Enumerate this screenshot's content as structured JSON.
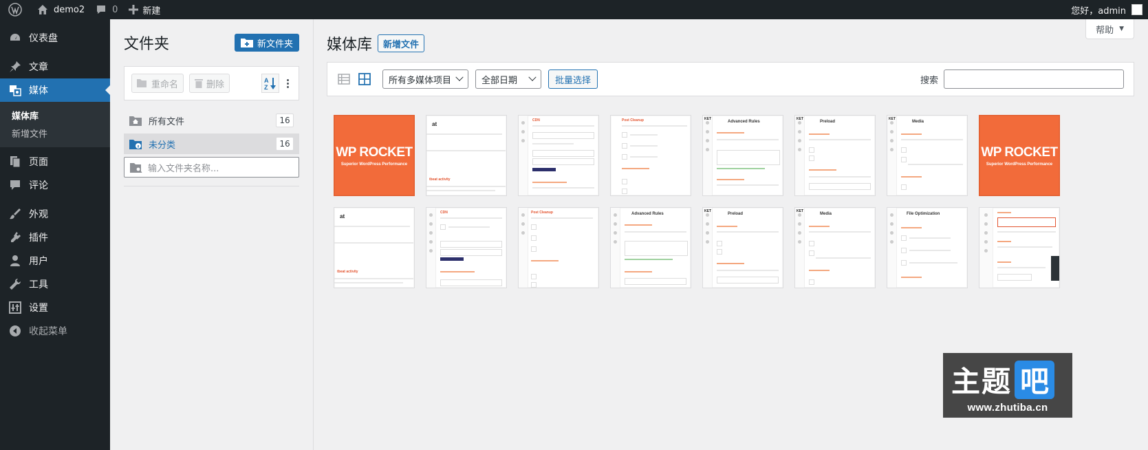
{
  "adminbar": {
    "site_name": "demo2",
    "comments_count": "0",
    "new_label": "新建",
    "greeting": "您好，admin"
  },
  "menu": {
    "dashboard": "仪表盘",
    "posts": "文章",
    "media": "媒体",
    "media_sub": [
      "媒体库",
      "新增文件"
    ],
    "pages": "页面",
    "comments": "评论",
    "appearance": "外观",
    "plugins": "插件",
    "users": "用户",
    "tools": "工具",
    "settings": "设置",
    "collapse": "收起菜单"
  },
  "folders": {
    "title": "文件夹",
    "new_folder": "新文件夹",
    "rename": "重命名",
    "delete": "删除",
    "sort_label": "AZ",
    "items": [
      {
        "label": "所有文件",
        "count": "16"
      },
      {
        "label": "未分类",
        "count": "16"
      }
    ],
    "input_placeholder": "输入文件夹名称..."
  },
  "main": {
    "help": "帮助",
    "title": "媒体库",
    "add_new": "新增文件",
    "filter_type": "所有多媒体项目",
    "filter_date": "全部日期",
    "bulk_select": "批量选择",
    "search_label": "搜索",
    "search_value": ""
  },
  "thumbnails": {
    "rocket_big": "WP ROCKET",
    "rocket_small": "Superior WordPress Performance",
    "heartbeat_t": "at",
    "heartbeat_red": "tbeat activity",
    "cdn": "CDN",
    "db_cleanup": "Post Cleanup",
    "advanced_rules": "Advanced Rules",
    "preload": "Preload",
    "media": "Media",
    "file_opt": "File Optimization",
    "ket": "KET"
  },
  "watermark": {
    "text_main": "主题",
    "text_badge": "吧",
    "url": "www.zhutiba.cn"
  },
  "colors": {
    "accent": "#2271b1",
    "adminbar": "#1d2327",
    "rocket": "#f26b3a"
  }
}
